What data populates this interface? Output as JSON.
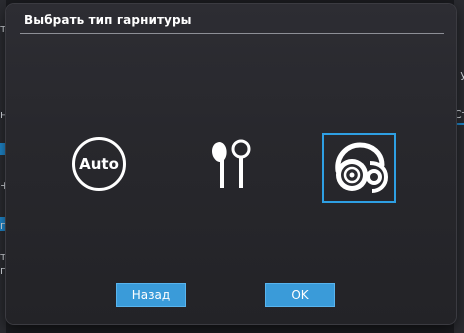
{
  "dialog": {
    "title": "Выбрать тип гарнитуры",
    "options": [
      {
        "id": "auto",
        "label": "Auto",
        "icon": "auto-icon",
        "selected": false
      },
      {
        "id": "earbuds",
        "icon": "earbuds-icon",
        "selected": false
      },
      {
        "id": "headphones",
        "icon": "headphones-icon",
        "selected": true
      }
    ],
    "buttons": {
      "back_label": "Назад",
      "ok_label": "OK"
    }
  },
  "background": {
    "right_fragments": [
      "о у",
      "Ст"
    ],
    "left_fragments": [
      "т",
      "н",
      "+",
      "п",
      "т",
      "п"
    ]
  },
  "colors": {
    "accent": "#2e9fe3",
    "button": "#3a9bd9",
    "dialog_bg": "#2a2a2f",
    "text": "#ffffff"
  }
}
